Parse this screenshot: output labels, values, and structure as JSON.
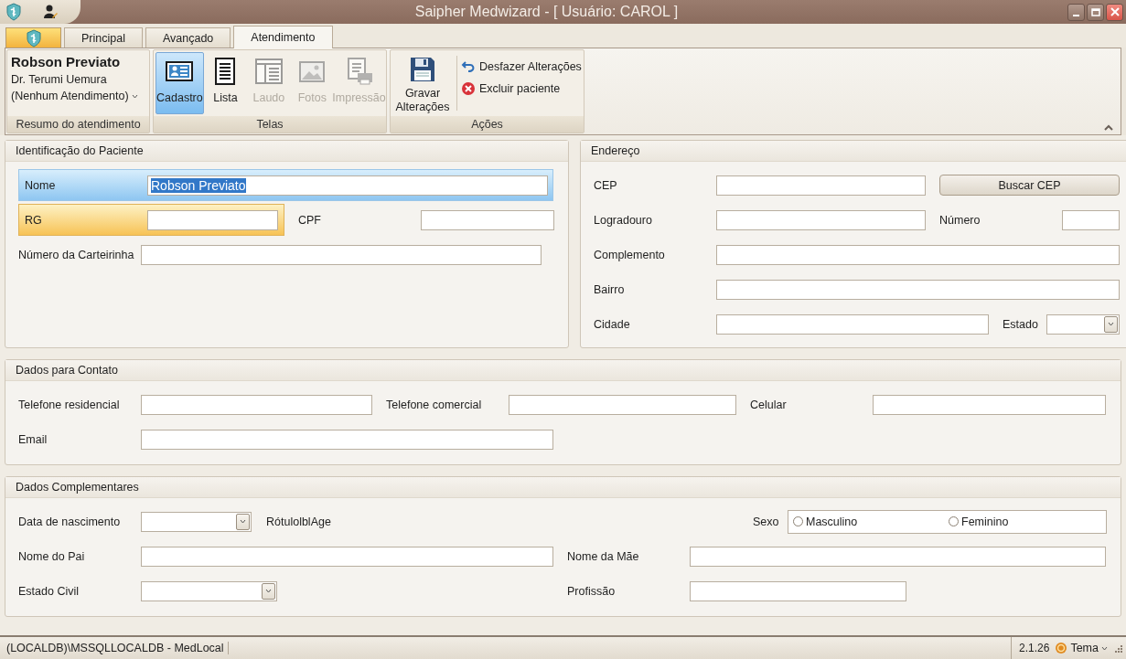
{
  "window": {
    "title": "Saipher Medwizard - [ Usuário: CAROL ]"
  },
  "ribbon": {
    "tabs": [
      {
        "label": "Principal",
        "selected": false
      },
      {
        "label": "Avançado",
        "selected": false
      },
      {
        "label": "Atendimento",
        "selected": true
      }
    ],
    "groups": [
      {
        "kind": "summary",
        "title": "Resumo do atendimento",
        "patient": "Robson Previato",
        "doctor": "Dr. Terumi Uemura",
        "attendance": "(Nenhum Atendimento)"
      },
      {
        "kind": "screens",
        "title": "Telas",
        "buttons": [
          {
            "label": "Cadastro",
            "selected": true,
            "disabled": false
          },
          {
            "label": "Lista",
            "selected": false,
            "disabled": false
          },
          {
            "label": "Laudo",
            "selected": false,
            "disabled": true
          },
          {
            "label": "Fotos",
            "selected": false,
            "disabled": true
          },
          {
            "label": "Impressão",
            "selected": false,
            "disabled": true
          }
        ]
      },
      {
        "kind": "actions",
        "title": "Ações",
        "buttons": [
          {
            "label": "Gravar Alterações",
            "kind": "large"
          },
          {
            "label": "Desfazer Alterações",
            "kind": "small"
          },
          {
            "label": "Excluir paciente",
            "kind": "small"
          }
        ]
      }
    ]
  },
  "sections": [
    {
      "title": "Identificação do Paciente",
      "rows": [
        [
          {
            "kind": "text",
            "label": "Nome",
            "value": "Robson Previato",
            "value_selected": true,
            "focused": true
          }
        ],
        [
          {
            "kind": "text",
            "label": "RG",
            "required": true
          },
          {
            "kind": "text",
            "label": "CPF"
          }
        ],
        [
          {
            "kind": "text",
            "label": "Número da Carteirinha"
          }
        ]
      ]
    },
    {
      "title": "Endereço",
      "rows": [
        [
          {
            "kind": "text",
            "label": "CEP"
          },
          {
            "kind": "button",
            "label": "Buscar CEP"
          }
        ],
        [
          {
            "kind": "text",
            "label": "Logradouro"
          },
          {
            "kind": "text",
            "label": "Número"
          }
        ],
        [
          {
            "kind": "text",
            "label": "Complemento"
          }
        ],
        [
          {
            "kind": "text",
            "label": "Bairro"
          }
        ],
        [
          {
            "kind": "text",
            "label": "Cidade"
          },
          {
            "kind": "combo",
            "label": "Estado"
          }
        ]
      ]
    },
    {
      "title": "Dados para Contato",
      "rows": [
        [
          {
            "kind": "text",
            "label": "Telefone residencial"
          },
          {
            "kind": "text",
            "label": "Telefone comercial"
          },
          {
            "kind": "text",
            "label": "Celular"
          }
        ],
        [
          {
            "kind": "text",
            "label": "Email"
          }
        ]
      ]
    },
    {
      "title": "Dados Complementares",
      "rows": [
        [
          {
            "kind": "combo",
            "label": "Data de nascimento"
          },
          {
            "kind": "note",
            "label": "RótulolblAge"
          },
          {
            "kind": "radio",
            "label": "Sexo",
            "options": [
              {
                "label": "Masculino",
                "selected": false
              },
              {
                "label": "Feminino",
                "selected": false
              }
            ]
          }
        ],
        [
          {
            "kind": "text",
            "label": "Nome do Pai"
          },
          {
            "kind": "text",
            "label": "Nome da Mãe"
          }
        ],
        [
          {
            "kind": "combo",
            "label": "Estado Civil"
          },
          {
            "kind": "text",
            "label": "Profissão"
          }
        ]
      ]
    }
  ],
  "status_bar": {
    "connection": "(LOCALDB)\\MSSQLLOCALDB - MedLocal",
    "version": "2.1.26",
    "theme": "Tema"
  }
}
